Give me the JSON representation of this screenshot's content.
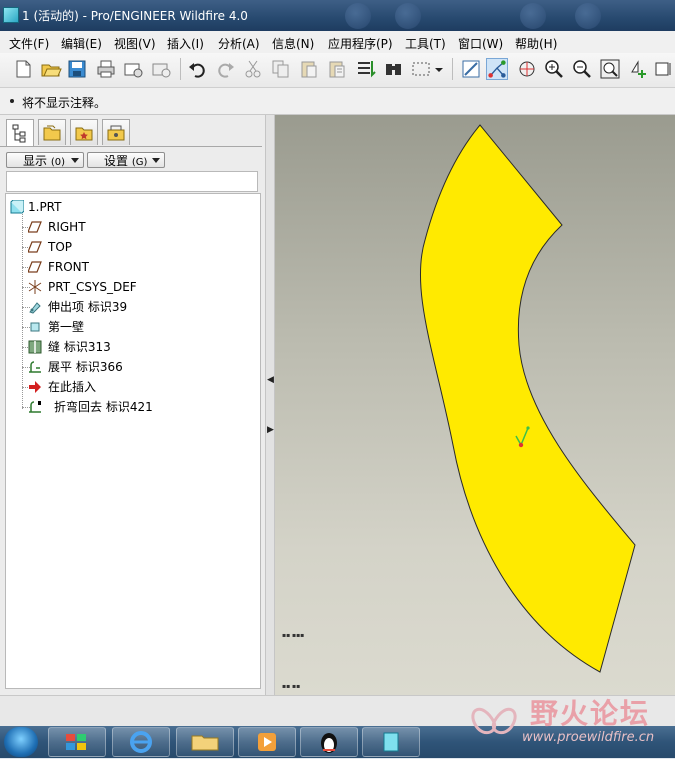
{
  "window": {
    "title": "1 (活动的) - Pro/ENGINEER Wildfire 4.0"
  },
  "menu": [
    "文件(F)",
    "编辑(E)",
    "视图(V)",
    "插入(I)",
    "分析(A)",
    "信息(N)",
    "应用程序(P)",
    "工具(T)",
    "窗口(W)",
    "帮助(H)"
  ],
  "toolbar": {
    "icons": [
      "new-icon",
      "open-icon",
      "save-icon",
      "print-icon",
      "send-icon",
      "send-alt-icon",
      "undo-icon",
      "redo-icon",
      "cut-icon",
      "copy-icon",
      "paste-icon",
      "paste-special-icon",
      "regenerate-icon",
      "find-icon",
      "select-box-icon",
      "select-dropdown-icon",
      "repaint-icon",
      "orient-icon",
      "spin-center-icon",
      "zoom-in-icon",
      "zoom-out-icon",
      "refit-icon",
      "named-view-icon",
      "view-manager-icon"
    ],
    "active_icon": "orient-icon"
  },
  "message": {
    "text": "将不显示注释。"
  },
  "panel": {
    "tabs": [
      "model-tree-tab",
      "folder-browser-tab",
      "favorites-tab",
      "connections-tab"
    ],
    "show_label": "显示",
    "show_shortcut": "(0)",
    "settings_label": "设置",
    "settings_shortcut": "(G)",
    "tree": [
      {
        "label": "1.PRT",
        "icon": "part-icon"
      },
      {
        "label": "RIGHT",
        "icon": "datum-plane-icon"
      },
      {
        "label": "TOP",
        "icon": "datum-plane-icon"
      },
      {
        "label": "FRONT",
        "icon": "datum-plane-icon"
      },
      {
        "label": "PRT_CSYS_DEF",
        "icon": "csys-icon"
      },
      {
        "label": "伸出项 标识39",
        "icon": "protrusion-icon"
      },
      {
        "label": "第一壁",
        "icon": "first-wall-icon"
      },
      {
        "label": "缝 标识313",
        "icon": "rip-icon"
      },
      {
        "label": "展平 标识366",
        "icon": "unbend-icon"
      },
      {
        "label": "在此插入",
        "icon": "insert-here-icon"
      },
      {
        "label": "折弯回去 标识421",
        "icon": "bendback-icon"
      }
    ]
  },
  "colors": {
    "part_fill": "#ffea00",
    "insert_arrow": "#d32020",
    "title_bar": "#2b4b70"
  },
  "watermark": {
    "text": "野火论坛",
    "url": "www.proewildfire.cn"
  }
}
